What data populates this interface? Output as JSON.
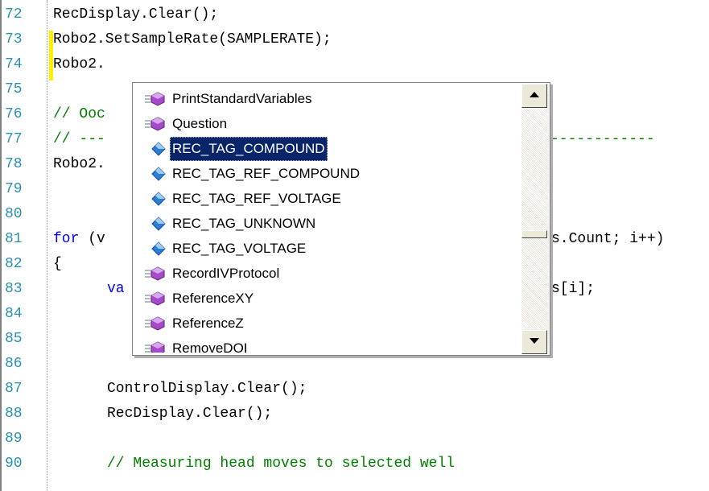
{
  "editor": {
    "lines": [
      {
        "num": "72",
        "indent": 0,
        "text": "RecDisplay.Clear();"
      },
      {
        "num": "73",
        "indent": 0,
        "text": "Robo2.SetSampleRate(SAMPLERATE);"
      },
      {
        "num": "74",
        "indent": 0,
        "text": "Robo2."
      },
      {
        "num": "75",
        "indent": 0,
        "text": ""
      },
      {
        "num": "76",
        "indent": 0,
        "text": "// Ooc"
      },
      {
        "num": "77",
        "indent": 0,
        "text": "// ---",
        "tail": "------------"
      },
      {
        "num": "78",
        "indent": 0,
        "text": "Robo2."
      },
      {
        "num": "79",
        "indent": 0,
        "text": ""
      },
      {
        "num": "80",
        "indent": 0,
        "text": ""
      },
      {
        "num": "81",
        "indent": 0,
        "keyword": "for",
        "text": " (v",
        "tail": "s.Count; i++)"
      },
      {
        "num": "82",
        "indent": 0,
        "text": "{"
      },
      {
        "num": "83",
        "indent": 1,
        "keyword": "va",
        "text": "",
        "tail": "s[i];"
      },
      {
        "num": "84",
        "indent": 0,
        "text": ""
      },
      {
        "num": "85",
        "indent": 0,
        "text": ""
      },
      {
        "num": "86",
        "indent": 0,
        "text": ""
      },
      {
        "num": "87",
        "indent": 1,
        "text": "ControlDisplay.Clear();"
      },
      {
        "num": "88",
        "indent": 1,
        "text": "RecDisplay.Clear();"
      },
      {
        "num": "89",
        "indent": 0,
        "text": ""
      },
      {
        "num": "90",
        "indent": 1,
        "text": "// Measuring head moves to selected well"
      }
    ]
  },
  "completion": {
    "items": [
      {
        "label": "PrintStandardVariables",
        "icon": "method-icon"
      },
      {
        "label": "Question",
        "icon": "method-icon"
      },
      {
        "label": "REC_TAG_COMPOUND",
        "icon": "enum-member-icon",
        "selected": true
      },
      {
        "label": "REC_TAG_REF_COMPOUND",
        "icon": "enum-member-icon"
      },
      {
        "label": "REC_TAG_REF_VOLTAGE",
        "icon": "enum-member-icon"
      },
      {
        "label": "REC_TAG_UNKNOWN",
        "icon": "enum-member-icon"
      },
      {
        "label": "REC_TAG_VOLTAGE",
        "icon": "enum-member-icon"
      },
      {
        "label": "RecordIVProtocol",
        "icon": "method-icon"
      },
      {
        "label": "ReferenceXY",
        "icon": "method-icon"
      },
      {
        "label": "ReferenceZ",
        "icon": "method-icon"
      },
      {
        "label": "RemoveDOI",
        "icon": "method-icon"
      }
    ],
    "scroll_position": 0.57
  },
  "colors": {
    "line_number": "#2b91af",
    "keyword": "#0000ff",
    "comment": "#008000",
    "selection": "#0a246a",
    "change_marker": "#ffee00",
    "method_icon": "#a64ac9",
    "enum_icon": "#2a7fd4"
  }
}
